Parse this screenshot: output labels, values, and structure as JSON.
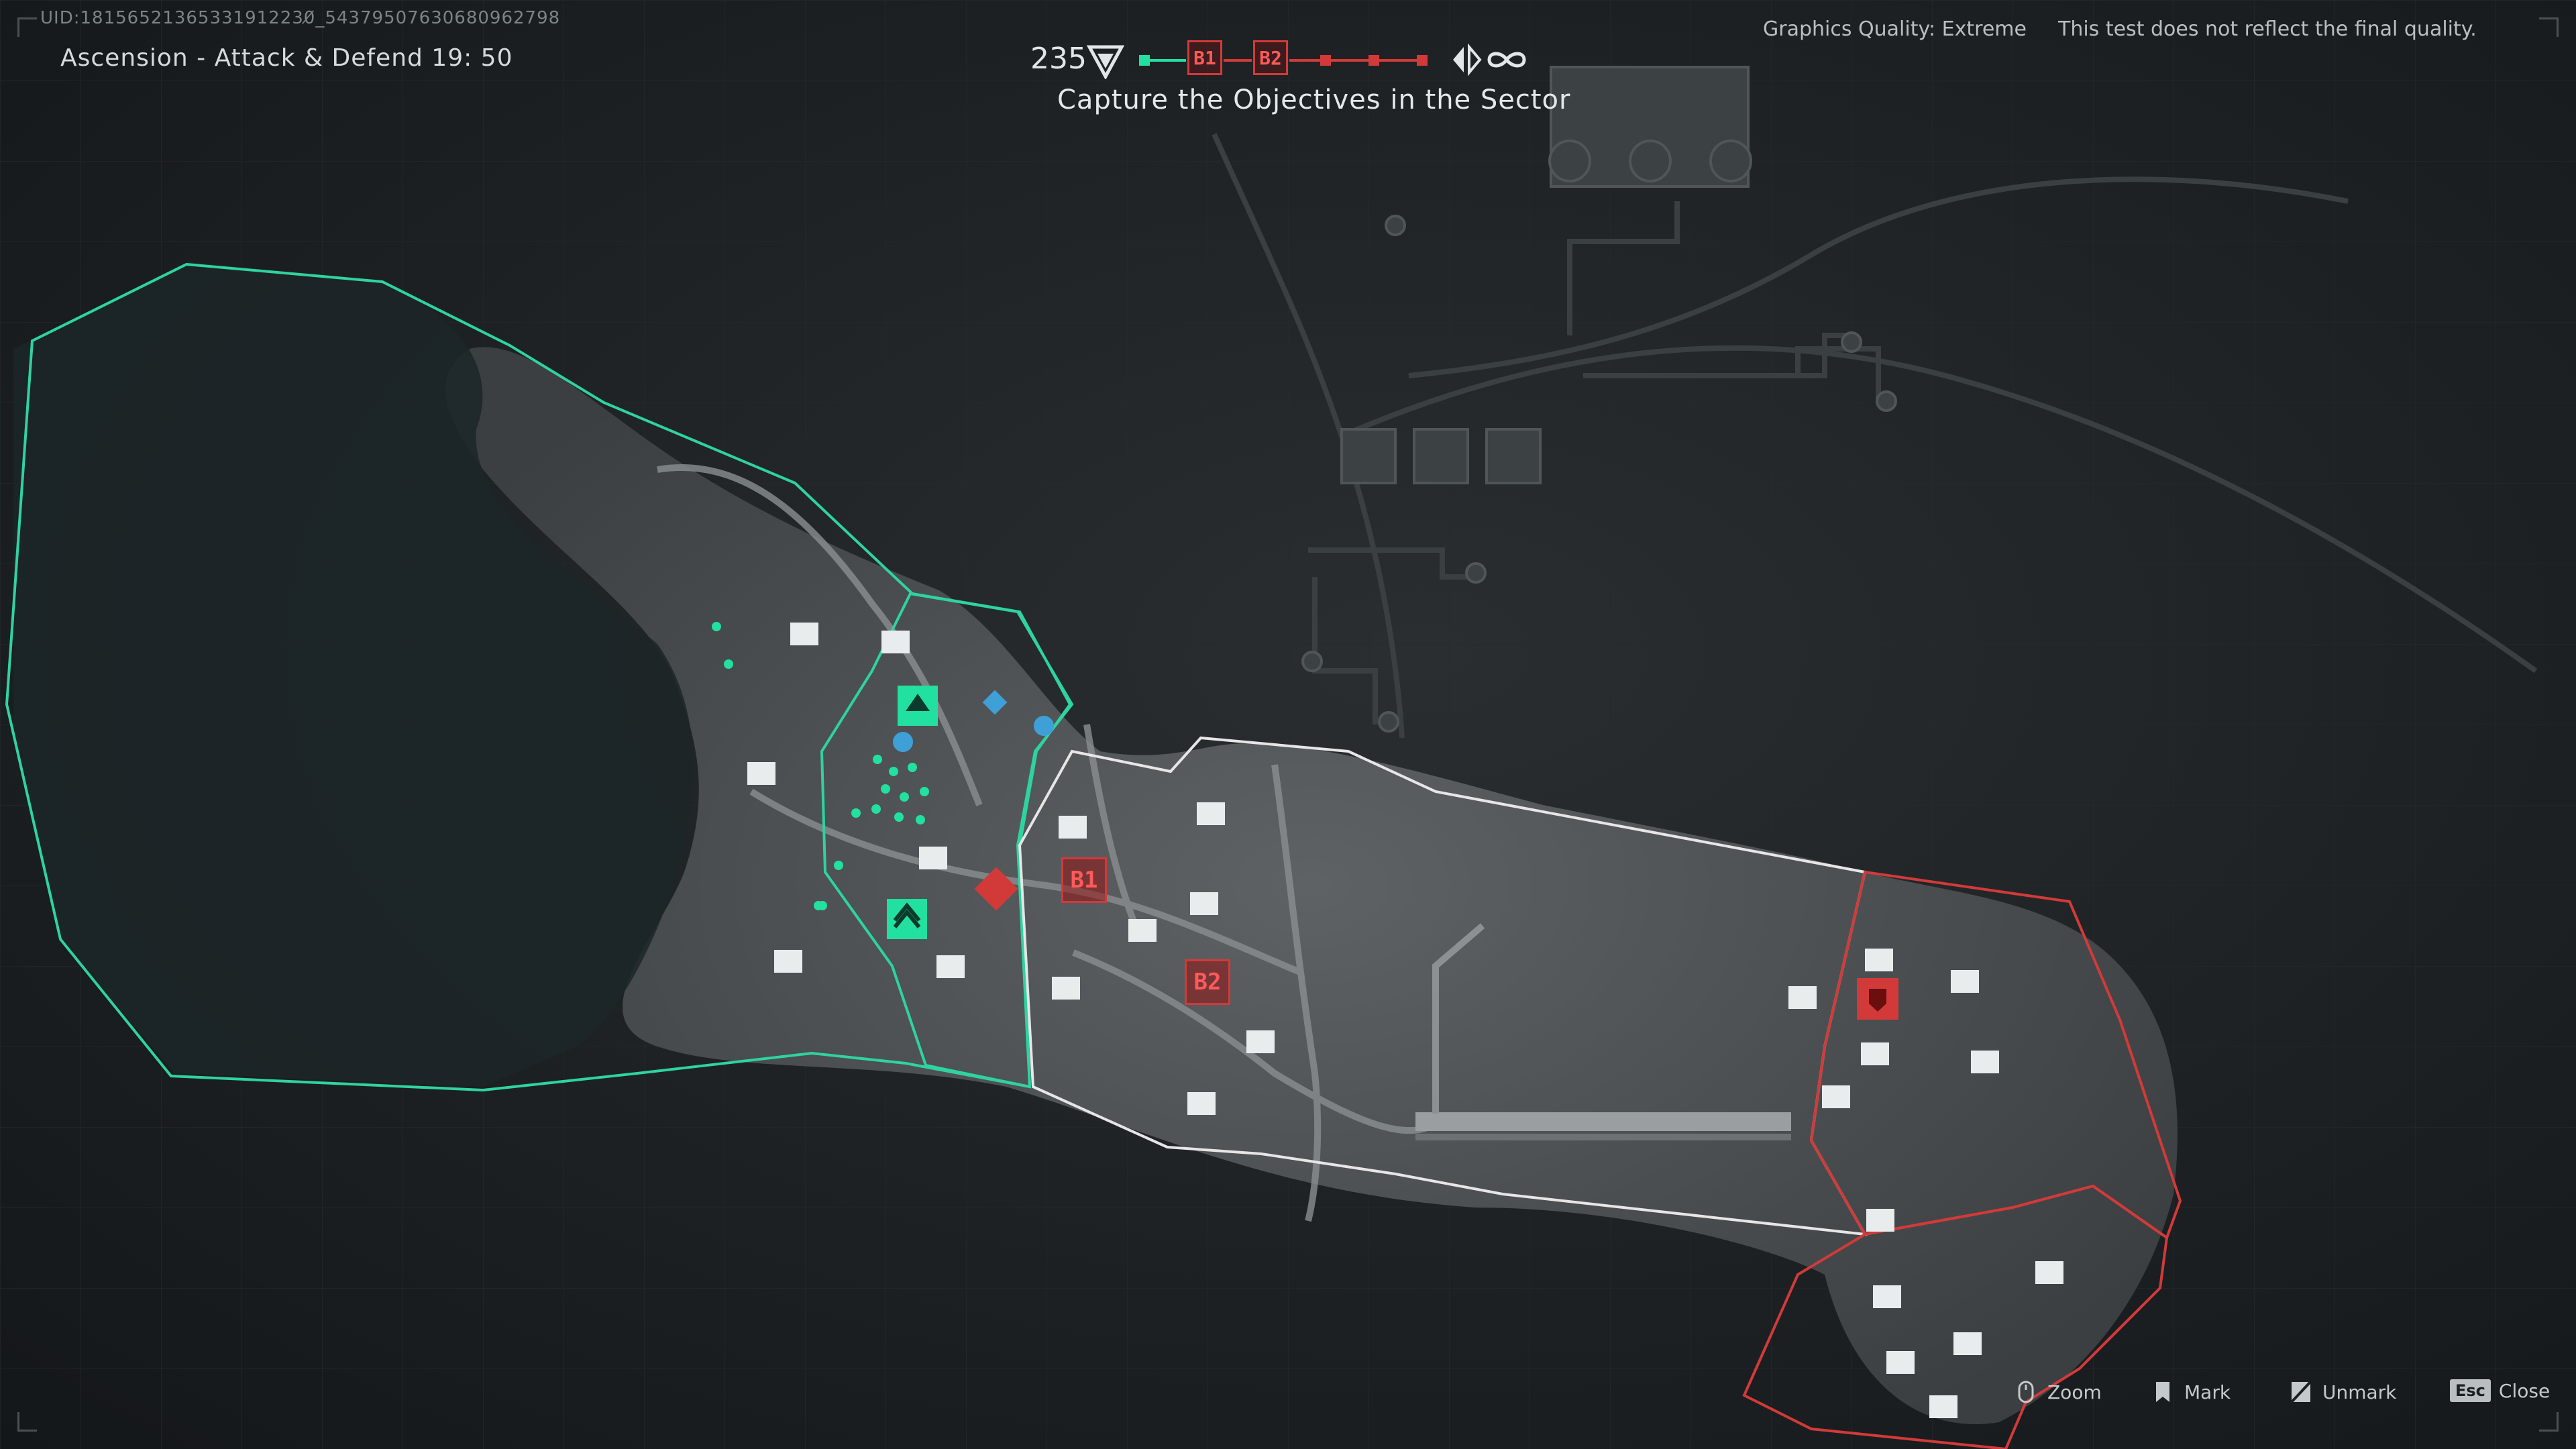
{
  "uid": "UID:18156521365331912230̸_54379507630680962798",
  "header": {
    "mode_title": "Ascension - Attack & Defend  19: 50",
    "graphics_quality": "Graphics Quality: Extreme",
    "disclaimer": "This test does not reflect the final quality."
  },
  "objective_bar": {
    "ticket_count": "235",
    "sectors": [
      {
        "label": "B1",
        "state": "enemy"
      },
      {
        "label": "B2",
        "state": "enemy"
      }
    ],
    "objective_text": "Capture the Objectives in the Sector",
    "colors": {
      "friendly": "#22e0a0",
      "enemy": "#d23a3a"
    }
  },
  "map": {
    "objectives": [
      {
        "label": "B1",
        "state": "enemy"
      },
      {
        "label": "B2",
        "state": "enemy"
      }
    ],
    "zones": [
      {
        "name": "friendly-deploy",
        "color": "#2fd3a0"
      },
      {
        "name": "friendly-zone",
        "color": "#2fd3a0"
      },
      {
        "name": "active-sector",
        "color": "#e6e6e6"
      },
      {
        "name": "enemy-sector",
        "color": "#d23a3a"
      },
      {
        "name": "enemy-deploy",
        "color": "#d23a3a"
      }
    ]
  },
  "hints": [
    {
      "icon": "zoom-icon",
      "label": "Zoom"
    },
    {
      "icon": "mark-icon",
      "label": "Mark"
    },
    {
      "icon": "unmark-icon",
      "label": "Unmark"
    },
    {
      "icon": "close-icon",
      "key": "Esc",
      "label": "Close"
    }
  ]
}
